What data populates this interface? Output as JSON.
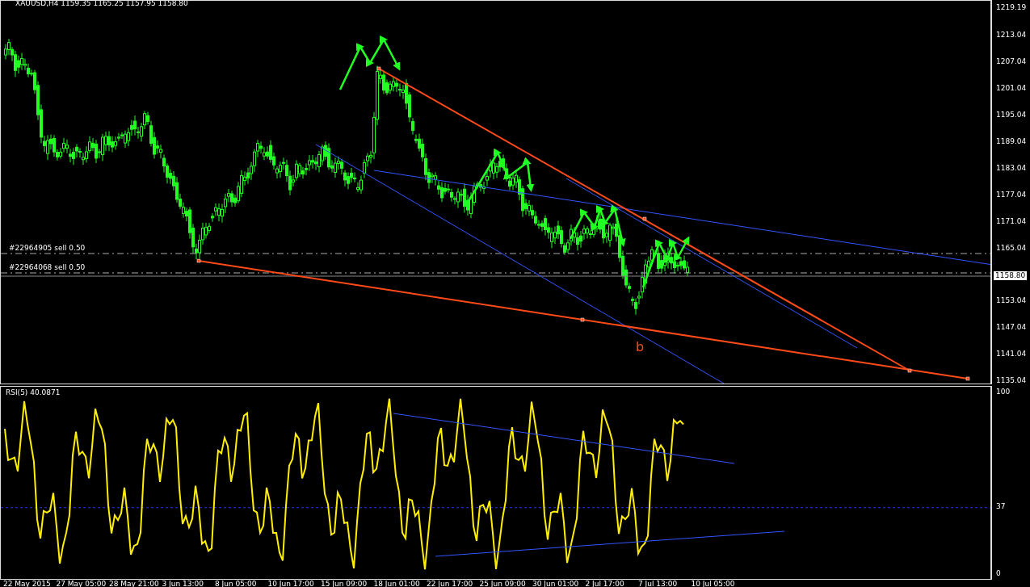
{
  "chart": {
    "title": "XAUUSD,H4 1159.35 1165.25 1157.95 1158.80",
    "price_ticks": [
      "1219.19",
      "1213.04",
      "1207.04",
      "1201.04",
      "1195.04",
      "1189.04",
      "1183.04",
      "1177.04",
      "1171.04",
      "1165.04",
      "1153.04",
      "1147.04",
      "1141.04",
      "1135.04"
    ],
    "current_price": "1158.80",
    "orders": [
      {
        "label": "#22964905 sell 0.50"
      },
      {
        "label": "#22964068 sell 0.50"
      }
    ],
    "annotation": "b"
  },
  "indicator": {
    "title": "RSI(5) 40.0871",
    "ticks": [
      "100",
      "37",
      "0"
    ]
  },
  "time_axis": [
    "22 May 2015",
    "27 May 05:00",
    "28 May 21:00",
    "3 Jun 13:00",
    "8 Jun 05:00",
    "10 Jun 17:00",
    "15 Jun 09:00",
    "18 Jun 01:00",
    "22 Jun 17:00",
    "25 Jun 09:00",
    "30 Jun 01:00",
    "2 Jul 17:00",
    "7 Jul 13:00",
    "10 Jul 05:00"
  ]
}
